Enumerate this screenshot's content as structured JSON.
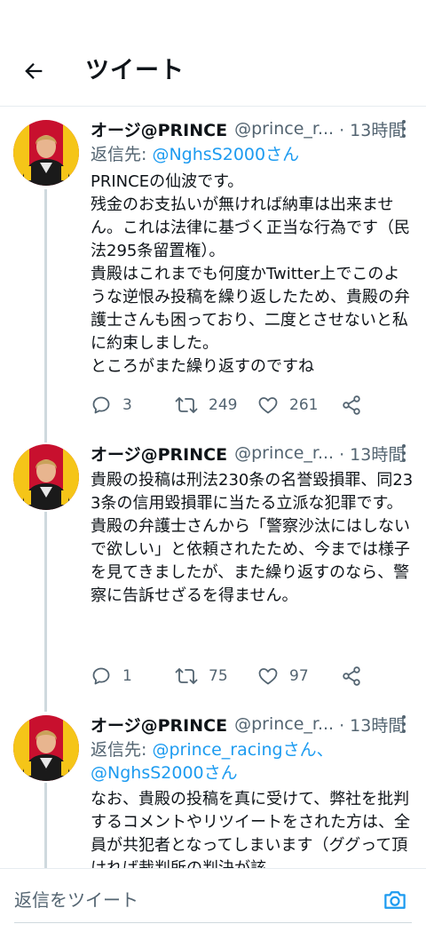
{
  "header": {
    "title": "ツイート"
  },
  "tweets": [
    {
      "name": "オージ@PRINCE",
      "handle": "@prince_r...",
      "time": "· 13時間",
      "reply_prefix": "返信先: ",
      "reply_to": "@NghsS2000さん",
      "text": "PRINCEの仙波です。\n残金のお支払いが無ければ納車は出来ません。これは法律に基づく正当な行為です（民法295条留置権）。\n貴殿はこれまでも何度かTwitter上でこのような逆恨み投稿を繰り返したため、貴殿の弁護士さんも困っており、二度とさせないと私に約束しました。\nところがまた繰り返すのですね",
      "replies": "3",
      "retweets": "249",
      "likes": "261"
    },
    {
      "name": "オージ@PRINCE",
      "handle": "@prince_r...",
      "time": "· 13時間",
      "text": "貴殿の投稿は刑法230条の名誉毀損罪、同233条の信用毀損罪に当たる立派な犯罪です。\n貴殿の弁護士さんから「警察沙汰にはしないで欲しい」と依頼されたため、今までは様子を見てきましたが、また繰り返すのなら、警察に告訴せざるを得ません。",
      "replies": "1",
      "retweets": "75",
      "likes": "97"
    },
    {
      "name": "オージ@PRINCE",
      "handle": "@prince_r...",
      "time": "· 13時間",
      "reply_prefix": "返信先: ",
      "reply_to_1": "@prince_racingさん、",
      "reply_to_2": "@NghsS2000さん",
      "text": "なお、貴殿の投稿を真に受けて、弊社を批判するコメントやリツイートをされた方は、全員が共犯者となってしまいます（ググって頂ければ裁判所の判決が該"
    }
  ],
  "reply_bar": {
    "placeholder": "返信をツイート"
  },
  "colors": {
    "accent": "#1d9bf0",
    "muted": "#536471",
    "text": "#0f1419",
    "divider": "#e6ecf0"
  }
}
